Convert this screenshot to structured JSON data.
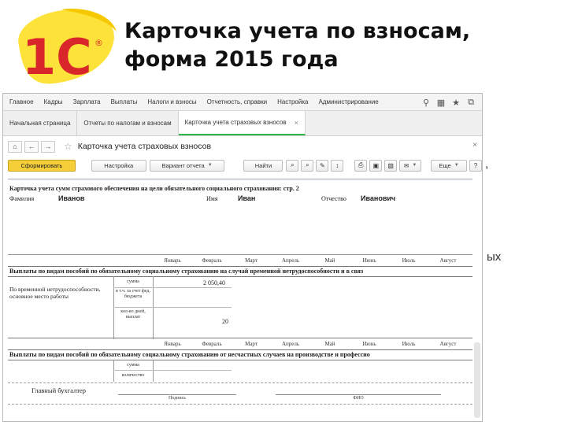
{
  "slide": {
    "title_line1": "Карточка учета по взносам,",
    "title_line2": "форма 2015 года",
    "peek_comma": ",",
    "peek_suffix": "ых"
  },
  "logo": {
    "text": "1С",
    "registered": "®"
  },
  "app": {
    "menu": [
      "Главное",
      "Кадры",
      "Зарплата",
      "Выплаты",
      "Налоги и взносы",
      "Отчетность, справки",
      "Настройка",
      "Администрирование"
    ],
    "tabs": [
      {
        "label": "Начальная страница",
        "active": false
      },
      {
        "label": "Отчеты по налогам и взносам",
        "active": false
      },
      {
        "label": "Карточка учета страховых взносов",
        "active": true
      }
    ],
    "window_title": "Карточка учета страховых взносов",
    "toolbar": {
      "generate": "Сформировать",
      "settings": "Настройка",
      "report_variant": "Вариант отчета",
      "find": "Найти",
      "more": "Еще",
      "help": "?"
    }
  },
  "report": {
    "heading": "Карточка учета сумм страхового обеспечения на цели обязательного социального страхования: стр. 2",
    "last_name_label": "Фамилия",
    "last_name": "Иванов",
    "first_name_label": "Имя",
    "first_name": "Иван",
    "patronymic_label": "Отчество",
    "patronymic": "Иванович",
    "months": [
      "Январь",
      "Февраль",
      "Март",
      "Апрель",
      "Май",
      "Июнь",
      "Июль",
      "Август"
    ],
    "section1_title": "Выплаты по видам пособий по обязательному социальному страхованию на случай временной нетрудоспособности и в связ",
    "section1_row_label": "По временной нетрудоспособности, основное место работы",
    "sum_label": "сумма",
    "fed_label": "в т.ч. за счет фед. бюджета",
    "days_label": "кол-во дней, выплат",
    "sum_jan": "2 050,40",
    "days_jan": "20",
    "section2_title": "Выплаты по видам пособий по обязательному социальному страхованию от несчастных случаев на производстве и профессио",
    "section2_sum_label": "сумма",
    "section2_count_label": "количество",
    "chief_accountant": "Главный бухгалтер",
    "signature_caption": "Подпись",
    "fio_caption": "ФИО"
  }
}
